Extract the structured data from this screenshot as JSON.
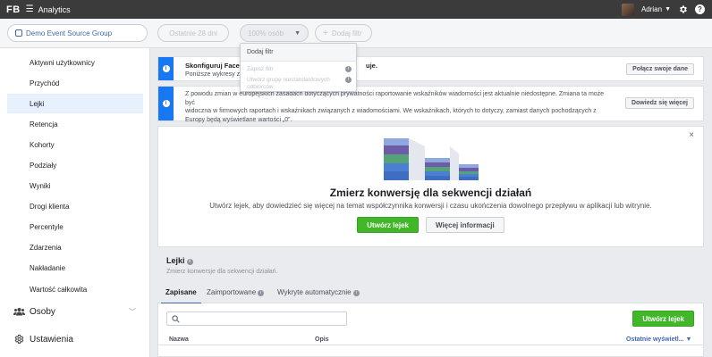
{
  "topbar": {
    "logo": "FB",
    "app_title": "Analytics",
    "user_name": "Adrian",
    "help_label": "?"
  },
  "filters": {
    "event_source_group": "Demo Event Source Group",
    "date_range": "Ostatnie 28 dni",
    "users_percent": "100% osób",
    "add_filter": "Dodaj filtr"
  },
  "dropdown": {
    "header": "Dodaj filtr",
    "items": [
      "Zapisz filtr",
      "Utwórz grupę niestandardowych odbiorców"
    ]
  },
  "sidebar": {
    "items": [
      {
        "label": "Aktywni użytkownicy"
      },
      {
        "label": "Przychód"
      },
      {
        "label": "Lejki"
      },
      {
        "label": "Retencja"
      },
      {
        "label": "Kohorty"
      },
      {
        "label": "Podziały"
      },
      {
        "label": "Wyniki"
      },
      {
        "label": "Drogi klienta"
      },
      {
        "label": "Percentyle"
      },
      {
        "label": "Zdarzenia"
      },
      {
        "label": "Nakładanie"
      },
      {
        "label": "Wartość całkowita"
      }
    ],
    "sections": [
      {
        "label": "Osoby"
      },
      {
        "label": "Ustawienia"
      }
    ]
  },
  "banners": {
    "connect": {
      "title": "Skonfiguruj Facebo",
      "title_suffix": "uje.",
      "text": "Poniższe wykresy z",
      "button": "Połącz swoje dane"
    },
    "notice": {
      "line1": "Z powodu zmian w europejskich zasadach dotyczących prywatności raportowanie wskaźników wiadomości jest aktualnie niedostępne. Zmiana ta może być",
      "line2": "widoczna w firmowych raportach i wskaźnikach związanych z wiadomościami. We wskaźnikach, których to dotyczy, zamiast danych pochodzących z",
      "line3": "Europy będą wyświetlane wartości „0”.",
      "button": "Dowiedz się więcej"
    }
  },
  "promo": {
    "title": "Zmierz konwersję dla sekwencji działań",
    "description": "Utwórz lejek, aby dowiedzieć się więcej na temat współczynnika konwersji i czasu ukończenia dowolnego przepływu w aplikacji lub witrynie.",
    "primary_button": "Utwórz lejek",
    "secondary_button": "Więcej informacji",
    "close": "×"
  },
  "funnels": {
    "title": "Lejki",
    "subtitle": "Zmierz konwersje dla sekwencji działań.",
    "tabs": [
      "Zapisane",
      "Zaimportowane",
      "Wykryte automatycznie"
    ],
    "search_placeholder": "",
    "create_button": "Utwórz lejek",
    "columns": [
      "Nazwa",
      "Opis",
      "Ostatnie wyświetl..."
    ]
  },
  "colors": {
    "accent": "#4267b2",
    "info_blue": "#1877f2",
    "green": "#42b72a",
    "topbar": "#3b3b3b"
  }
}
